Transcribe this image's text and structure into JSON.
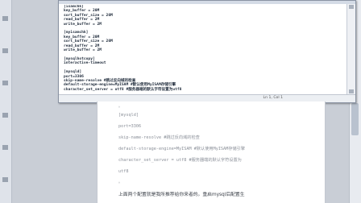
{
  "notepad": {
    "lines": [
      "[isamchk]",
      "key_buffer = 20M",
      "sort_buffer_size = 20M",
      "read_buffer = 2M",
      "write_buffer = 2M",
      "",
      "[myisamchk]",
      "key_buffer = 20M",
      "sort_buffer_size = 20M",
      "read_buffer = 2M",
      "write_buffer = 2M",
      "",
      "[mysqlhotcopy]",
      "interactive-timeout",
      "",
      "[mysqld]",
      "port=3306",
      "skip-name-resolve #跳过反向域的检查",
      "default-storage-engine=MyISAM #默认使用MyISAM存储引擎",
      "character_set_server = utf8 #服务器端的默认字符设置为utf8"
    ],
    "status": "Ln 1, Col 1"
  },
  "document": {
    "mysqld": "[mysqld]",
    "port": "port=3306",
    "skip": "skip-name-resolve #跳过反向域的检查",
    "engine": "default-storage-engine=MyISAM #默认使用MyISAM存储引擎",
    "charset_a": "character_set_server = utf8 #服务器端的默认字符设置为",
    "charset_b": "utf8",
    "dot": "。",
    "paragraph": "上面两个配置就是我所推荐给你来者的。重启mysql后配置生"
  }
}
